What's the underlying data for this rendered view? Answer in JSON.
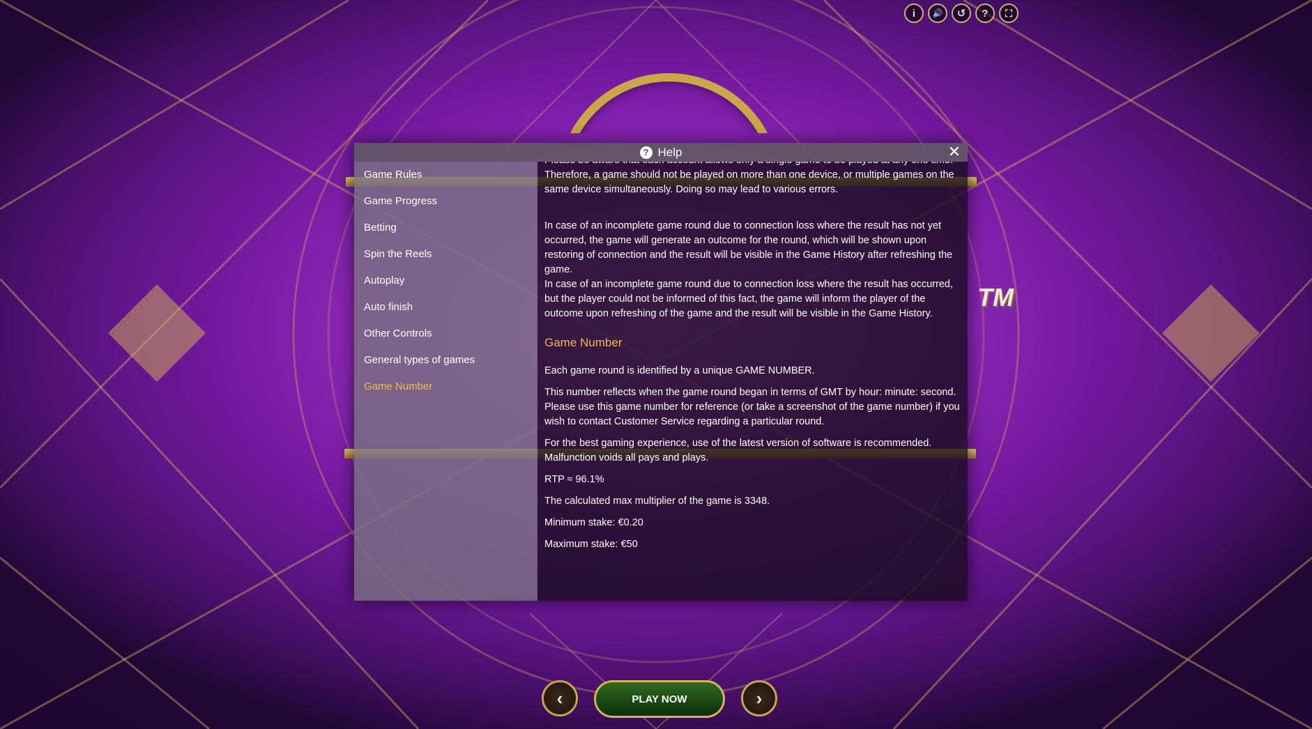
{
  "top_icons": [
    {
      "name": "info-icon",
      "glyph": "i"
    },
    {
      "name": "sound-icon",
      "glyph": "🔊"
    },
    {
      "name": "history-icon",
      "glyph": "↺"
    },
    {
      "name": "question-icon",
      "glyph": "?"
    },
    {
      "name": "fullscreen-icon",
      "glyph": "⛶"
    }
  ],
  "logo": {
    "tm": "TM"
  },
  "help": {
    "title": "Help",
    "close_glyph": "✕",
    "menu": [
      "Game Rules",
      "Game Progress",
      "Betting",
      "Spin the Reels",
      "Autoplay",
      "Auto finish",
      "Other Controls",
      "General types of games",
      "Game Number"
    ],
    "active_item": "Game Number",
    "content": {
      "p1": "Please be aware that each account allows only a single game to be played at any one time. Therefore, a game should not be played on more than one device, or multiple games on the same device simultaneously. Doing so may lead to various errors.",
      "p2": "In case of an incomplete game round due to connection loss where the result has not yet occurred, the game will generate an outcome for the round, which will be shown upon restoring of connection and the result will be visible in the Game History after refreshing the game.",
      "p3": "In case of an incomplete game round due to connection loss where the result has occurred, but the player could not be informed of this fact, the game will inform the player of the outcome upon refreshing of the game and the result will be visible in the Game History.",
      "section_title": "Game Number",
      "p4": "Each game round is identified by a unique GAME NUMBER.",
      "p5": "This number reflects when the game round began in terms of GMT by hour: minute: second. Please use this game number for reference (or take a screenshot of the game number) if you wish to contact Customer Service regarding a particular round.",
      "p6": "For the best gaming experience, use of the latest version of software is recommended. Malfunction voids all pays and plays.",
      "p7": "RTP ≈ 96.1%",
      "p8": "The calculated max multiplier of the game is 3348.",
      "p9": "Minimum stake: €0.20",
      "p10": "Maximum stake: €50"
    }
  },
  "controls": {
    "prev_glyph": "‹",
    "play_label": "PLAY NOW",
    "next_glyph": "›"
  }
}
